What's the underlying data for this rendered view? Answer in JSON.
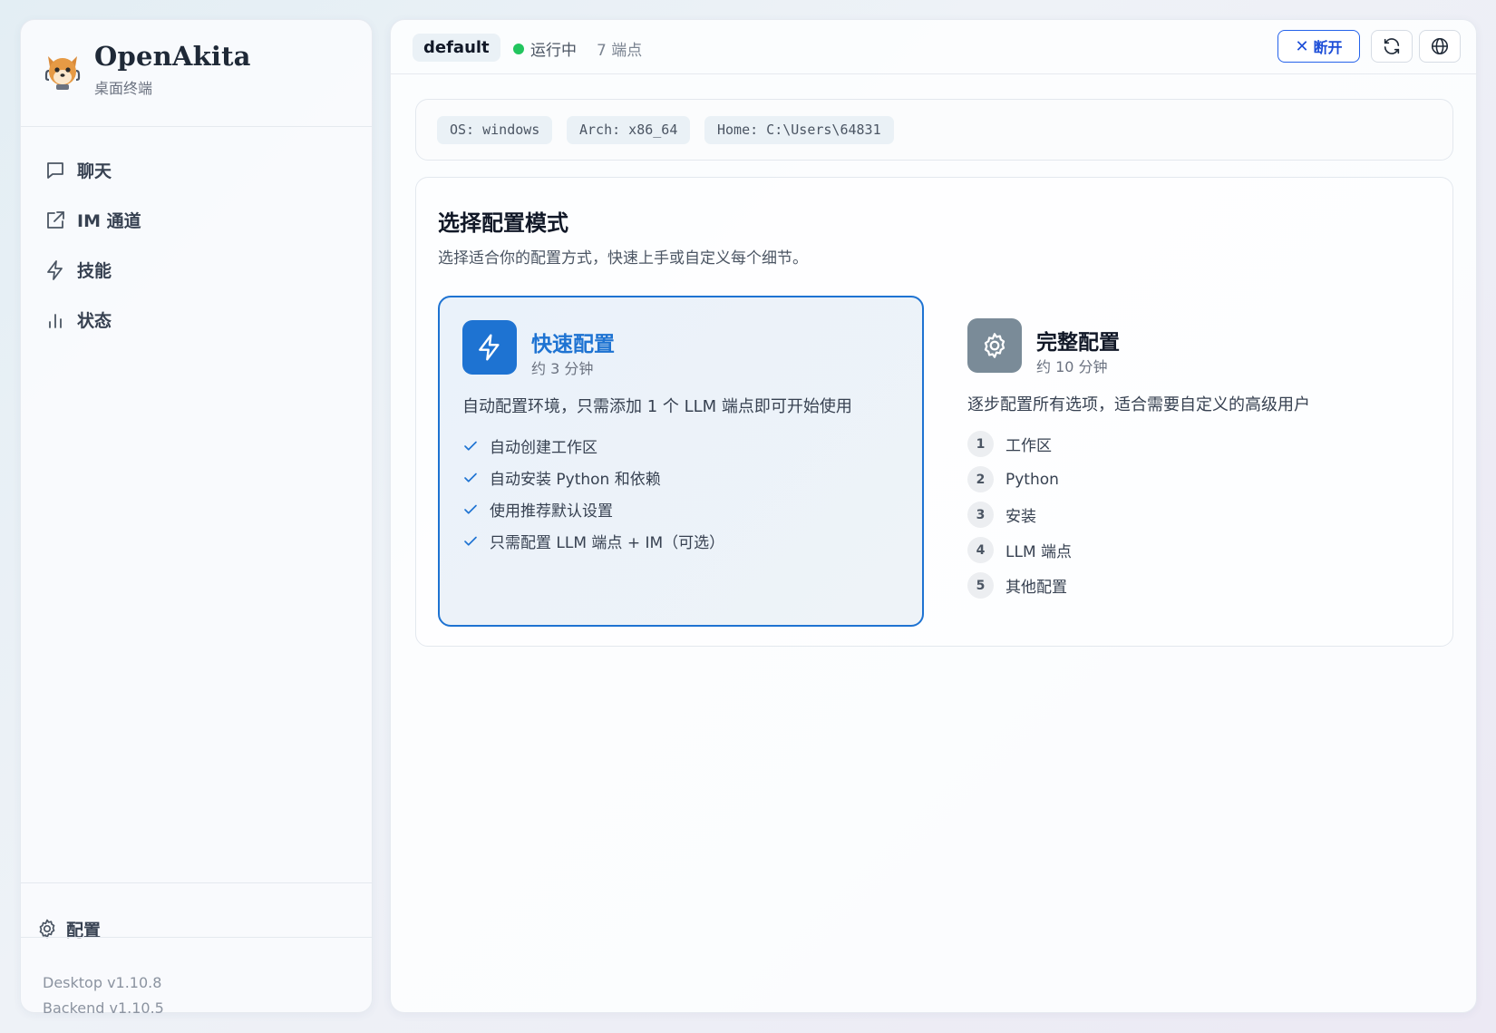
{
  "brand": {
    "name": "OpenAkita",
    "subtitle": "桌面终端"
  },
  "sidebar": {
    "items": [
      {
        "label": "聊天",
        "icon": "chat-icon"
      },
      {
        "label": "IM 通道",
        "icon": "share-icon"
      },
      {
        "label": "技能",
        "icon": "lightning-icon"
      },
      {
        "label": "状态",
        "icon": "bar-chart-icon"
      }
    ],
    "settings_label": "配置",
    "desktop_version": "Desktop v1.10.8",
    "backend_version": "Backend v1.10.5"
  },
  "topbar": {
    "workspace": "default",
    "status": "运行中",
    "status_color": "#22c55e",
    "endpoints": "7 端点",
    "disconnect_label": "断开",
    "refresh_icon": "refresh-icon",
    "language_icon": "globe-icon"
  },
  "sysinfo": {
    "os": "OS: windows",
    "arch": "Arch: x86_64",
    "home": "Home: C:\\Users\\64831"
  },
  "setup": {
    "title": "选择配置模式",
    "description": "选择适合你的配置方式，快速上手或自定义每个细节。",
    "quick": {
      "title": "快速配置",
      "time": "约 3 分钟",
      "description": "自动配置环境，只需添加 1 个 LLM 端点即可开始使用",
      "features": [
        "自动创建工作区",
        "自动安装 Python 和依赖",
        "使用推荐默认设置",
        "只需配置 LLM 端点 + IM（可选）"
      ],
      "accent": "#1e73d2"
    },
    "full": {
      "title": "完整配置",
      "time": "约 10 分钟",
      "description": "逐步配置所有选项，适合需要自定义的高级用户",
      "steps": [
        {
          "num": "1",
          "label": "工作区"
        },
        {
          "num": "2",
          "label": "Python"
        },
        {
          "num": "3",
          "label": "安装"
        },
        {
          "num": "4",
          "label": "LLM 端点"
        },
        {
          "num": "5",
          "label": "其他配置"
        }
      ],
      "icon_color": "#7a8b98"
    }
  }
}
